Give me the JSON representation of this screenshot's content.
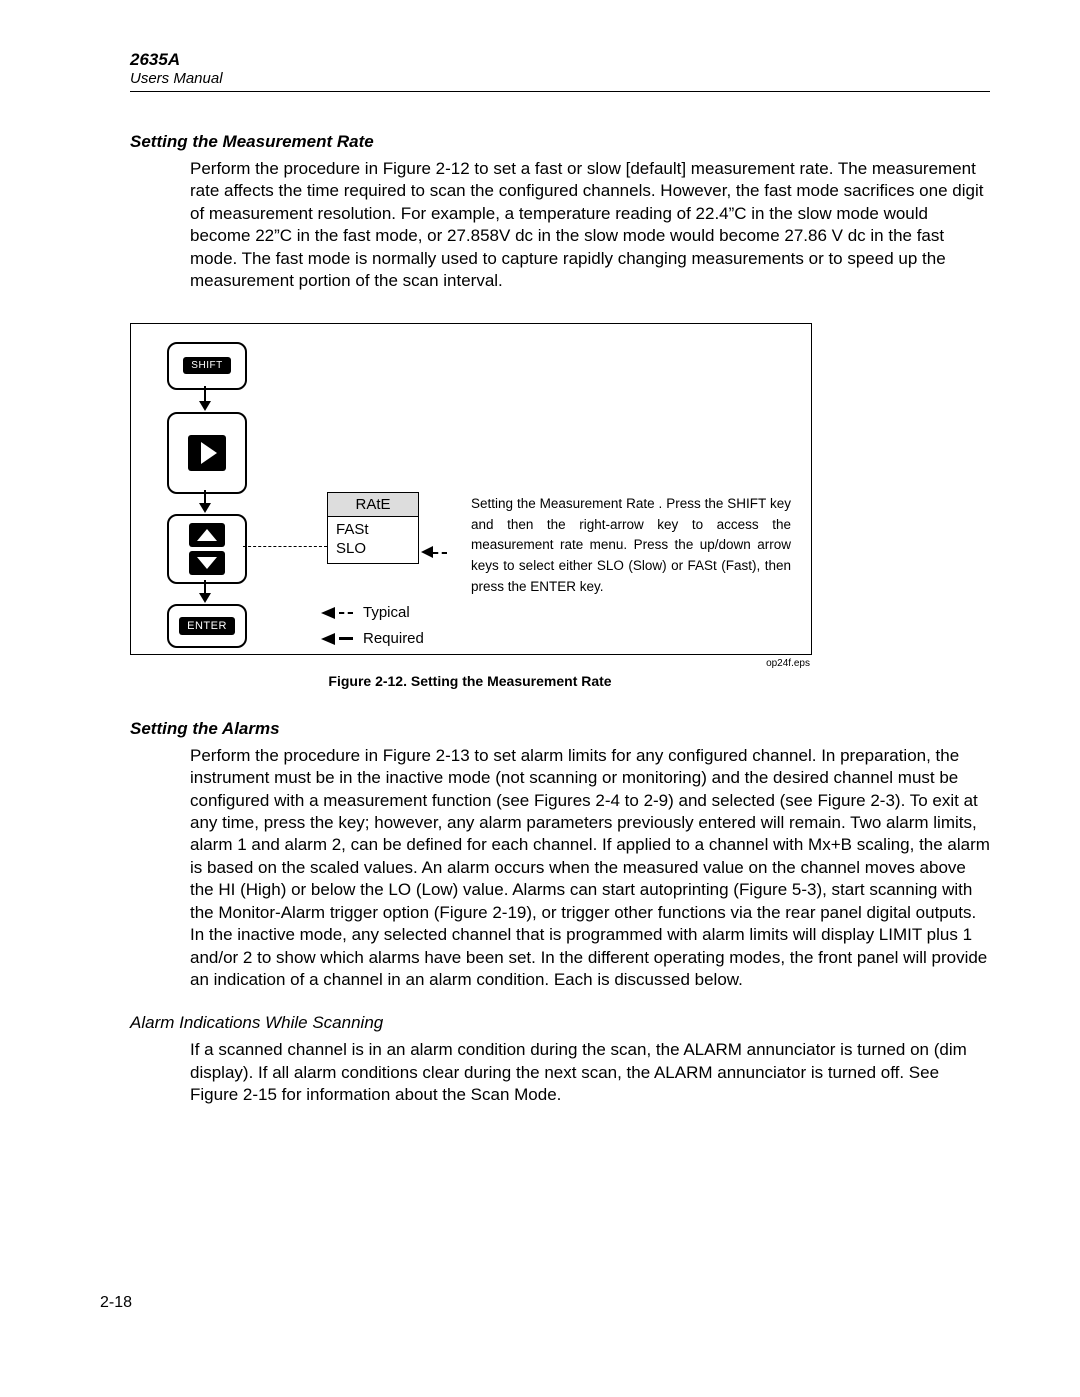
{
  "header": {
    "model": "2635A",
    "manual": "Users Manual"
  },
  "section1": {
    "heading": "Setting the Measurement Rate",
    "para": "Perform the procedure in Figure 2-12 to set a fast or slow [default] measurement rate. The measurement rate affects the time required to scan the configured channels. However, the fast mode sacrifices one digit of measurement resolution. For example, a temperature reading of 22.4”C in the slow mode would become 22”C in the fast mode, or 27.858V dc in the slow mode would become 27.86 V dc in the fast mode. The fast mode is normally used to capture rapidly changing measurements or to speed up the measurement portion of the scan interval."
  },
  "figure": {
    "shift": "SHIFT",
    "enter": "ENTER",
    "rate_header": "RAtE",
    "rate_opt1": "FASt",
    "rate_opt2": "SLO",
    "legend_typical": "Typical",
    "legend_required": "Required",
    "instructions": "Setting the Measurement Rate . Press the SHIFT key and then the right-arrow key to access the measurement rate menu. Press the up/down arrow keys to select either SLO (Slow) or FASt (Fast), then press the ENTER key.",
    "caption": "Figure 2-12. Setting the Measurement Rate",
    "eps": "op24f.eps"
  },
  "section2": {
    "heading": "Setting the Alarms",
    "para": "Perform the procedure in Figure 2-13 to set alarm limits for any configured channel. In preparation, the instrument must be in the inactive mode (not scanning or monitoring) and the desired channel must be configured with a measurement function (see Figures 2-4 to 2-9) and selected (see Figure 2-3). To exit at any time, press the key; however, any alarm parameters previously entered will remain. Two alarm limits, alarm 1 and alarm 2, can be defined for each channel. If applied to a channel with Mx+B scaling, the alarm is based on the scaled values. An alarm occurs when the measured value on the channel moves above the HI (High) or below the LO (Low) value. Alarms can start autoprinting (Figure 5-3), start scanning with the Monitor-Alarm trigger option (Figure 2-19), or trigger other functions via the rear panel digital outputs. In the inactive mode, any selected channel that is programmed with alarm limits will display LIMIT plus 1 and/or 2 to show which alarms have been set. In the different operating modes, the front panel will provide an indication of a channel in an alarm condition. Each is discussed below."
  },
  "section3": {
    "heading": "Alarm Indications While Scanning",
    "para": "If a scanned channel is in an alarm condition during the scan, the ALARM annunciator is turned on (dim display). If all alarm conditions clear during the next scan, the ALARM annunciator is turned off. See Figure 2-15 for information about the Scan Mode."
  },
  "pagenum": "2-18"
}
